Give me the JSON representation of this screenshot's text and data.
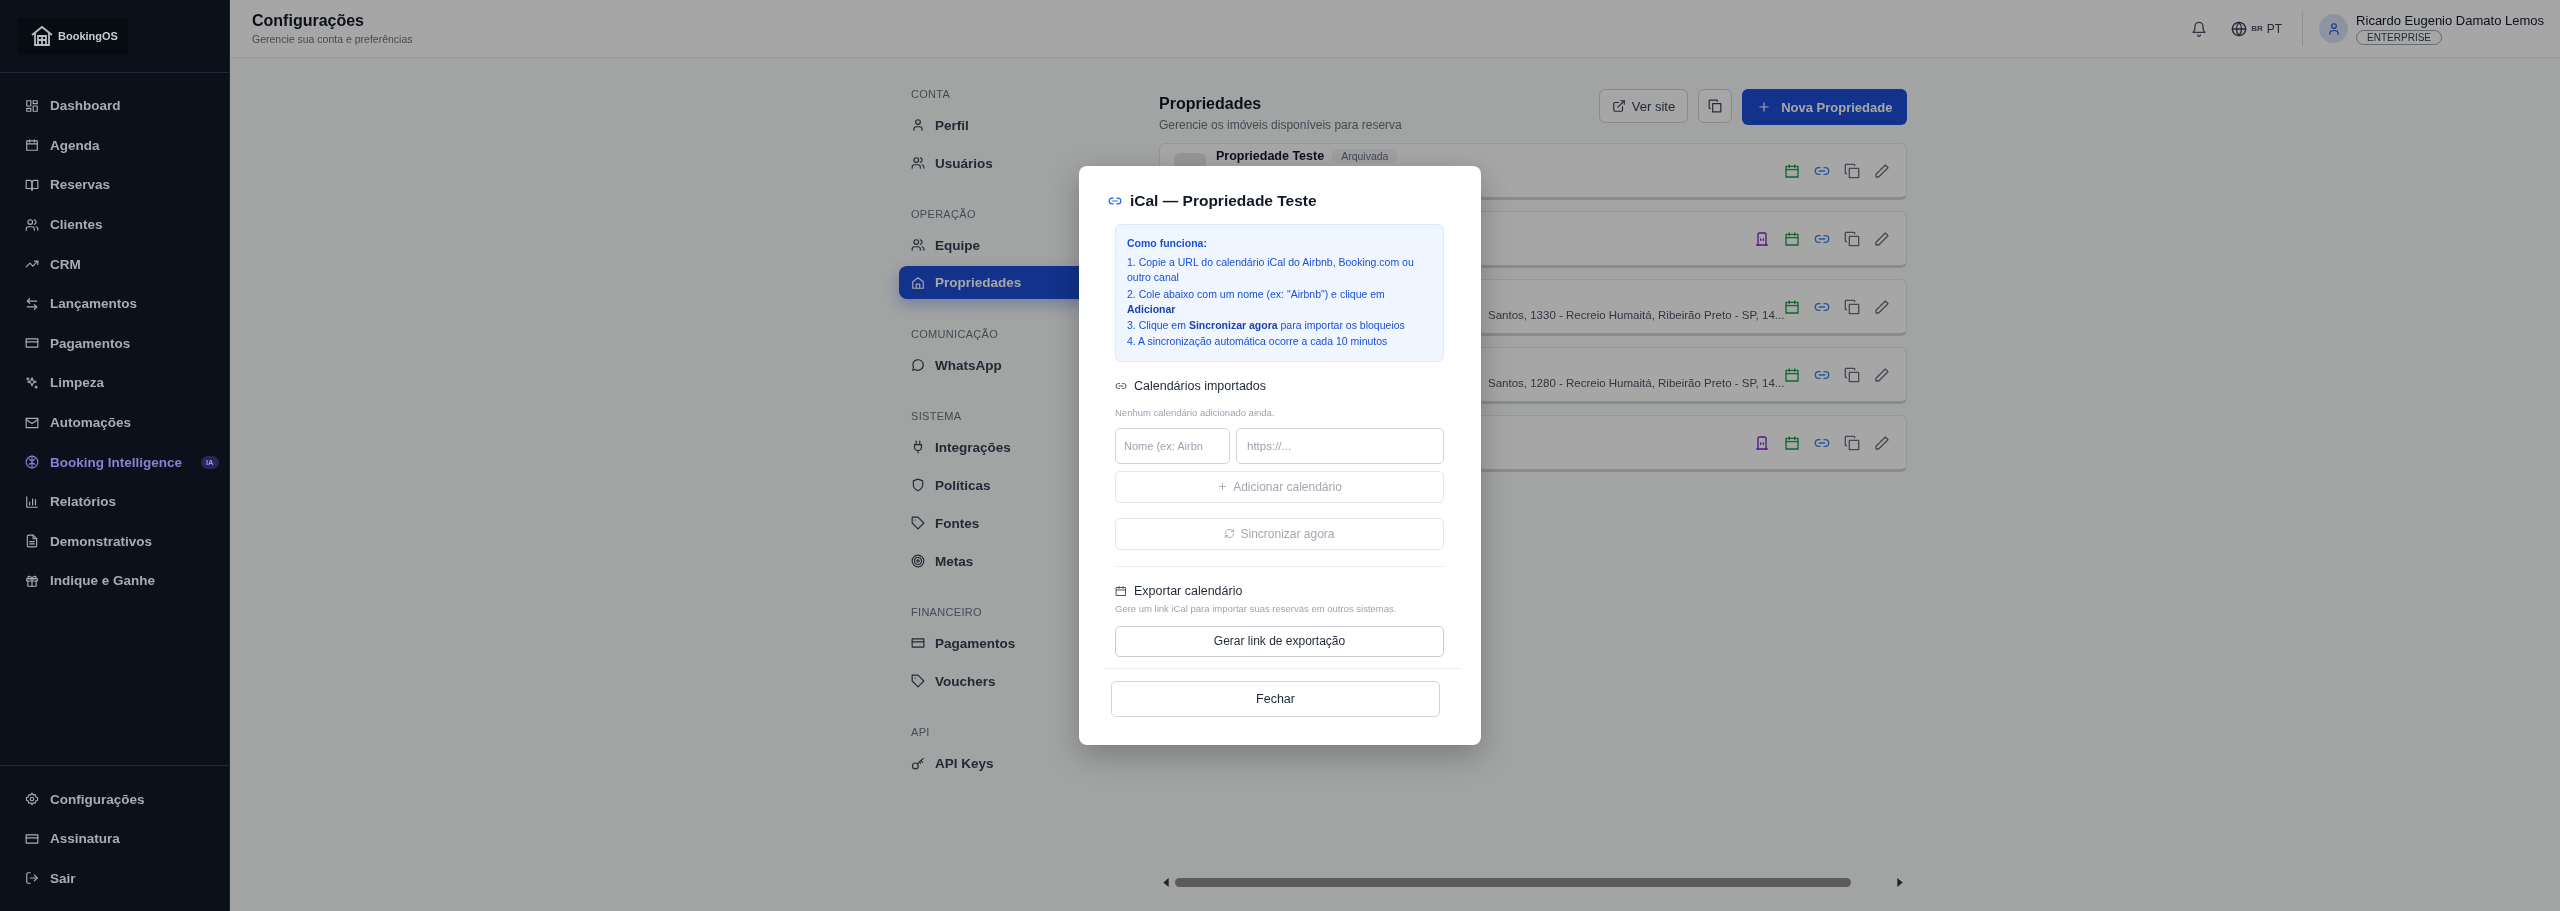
{
  "sidebar": {
    "logo": "BookingOS",
    "items": [
      {
        "label": "Dashboard",
        "kind": "link",
        "selected": false
      },
      {
        "label": "Agenda",
        "kind": "link",
        "selected": false
      },
      {
        "label": "Reservas",
        "kind": "link",
        "selected": false
      },
      {
        "label": "Clientes",
        "kind": "link",
        "selected": false
      },
      {
        "label": "CRM",
        "kind": "link",
        "selected": false
      },
      {
        "label": "Lançamentos",
        "kind": "link",
        "selected": false
      },
      {
        "label": "Pagamentos",
        "kind": "link",
        "selected": false
      },
      {
        "label": "Limpeza",
        "kind": "link",
        "selected": false
      },
      {
        "label": "Automações",
        "kind": "link",
        "selected": false
      },
      {
        "label": "Booking Intelligence",
        "kind": "featured",
        "badge": "IA",
        "selected": false
      },
      {
        "label": "Relatórios",
        "kind": "link",
        "selected": false
      },
      {
        "label": "Demonstrativos",
        "kind": "link",
        "selected": false
      },
      {
        "label": "Indique e Ganhe",
        "kind": "link",
        "selected": false
      }
    ],
    "footer_items": [
      {
        "label": "Configurações",
        "selected": false
      },
      {
        "label": "Assinatura",
        "selected": false
      },
      {
        "label": "Sair",
        "selected": false
      }
    ]
  },
  "header": {
    "title": "Configurações",
    "subtitle": "Gerencie sua conta e preferências",
    "language": {
      "flag": "BR",
      "code": "PT"
    },
    "user": {
      "name": "Ricardo Eugenio Damato Lemos",
      "plan": "ENTERPRISE"
    }
  },
  "settings_nav": [
    {
      "heading": "CONTA",
      "items": [
        {
          "label": "Perfil",
          "selected": false
        },
        {
          "label": "Usuários",
          "selected": false
        }
      ]
    },
    {
      "heading": "OPERAÇÃO",
      "items": [
        {
          "label": "Equipe",
          "selected": false
        },
        {
          "label": "Propriedades",
          "selected": true
        }
      ]
    },
    {
      "heading": "COMUNICAÇÃO",
      "items": [
        {
          "label": "WhatsApp",
          "selected": false
        }
      ]
    },
    {
      "heading": "SISTEMA",
      "items": [
        {
          "label": "Integrações",
          "selected": false
        },
        {
          "label": "Políticas",
          "selected": false
        },
        {
          "label": "Fontes",
          "selected": false
        },
        {
          "label": "Metas",
          "selected": false
        }
      ]
    },
    {
      "heading": "FINANCEIRO",
      "items": [
        {
          "label": "Pagamentos",
          "selected": false
        },
        {
          "label": "Vouchers",
          "selected": false
        }
      ]
    },
    {
      "heading": "API",
      "items": [
        {
          "label": "API Keys",
          "selected": false
        }
      ]
    }
  ],
  "properties": {
    "title": "Propriedades",
    "subtitle": "Gerencie os imóveis disponíveis para reserva",
    "view_site": "Ver site",
    "new_button": "Nova Propriedade",
    "rows": [
      {
        "name": "Propriedade Teste",
        "badge": "Arquivada",
        "door_icon": false
      },
      {
        "door_icon": true
      },
      {
        "address": "Santos, 1330 - Recreio Humaitá, Ribeirão Preto - SP, 14...",
        "door_icon": false
      },
      {
        "address": "Santos, 1280 - Recreio Humaitá, Ribeirão Preto - SP, 14...",
        "door_icon": false
      },
      {
        "door_icon": true
      }
    ]
  },
  "dialog": {
    "title": "iCal — Propriedade Teste",
    "info": {
      "heading": "Como funciona:",
      "steps": [
        "1. Copie a URL do calendário iCal do Airbnb, Booking.com ou outro canal",
        "2. Cole abaixo com um nome (ex: \"Airbnb\") e clique em **Adicionar**",
        "3. Clique em **Sincronizar agora** para importar os bloqueios",
        "4. A sincronização automática ocorre a cada 10 minutos"
      ]
    },
    "imported": {
      "title": "Calendários importados",
      "empty": "Nenhum calendário adicionado ainda.",
      "name_placeholder": "Nome (ex: Airbn",
      "url_placeholder": "https://...",
      "add_button": {
        "label": "Adicionar calendário",
        "disabled": true
      },
      "sync_button": {
        "label": "Sincronizar agora",
        "disabled": true
      }
    },
    "export": {
      "title": "Exportar calendário",
      "description": "Gere um link iCal para importar suas reservas em outros sistemas.",
      "button": {
        "label": "Gerar link de exportação",
        "disabled": false
      }
    },
    "close_button": "Fechar"
  }
}
